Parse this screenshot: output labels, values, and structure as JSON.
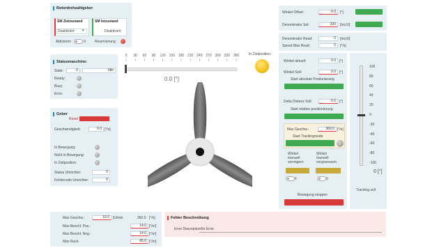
{
  "rotor": {
    "title": "Rotordrehzahlgeber",
    "soll_title": "SM Zielzustand",
    "soll_value": "Deaktiviert",
    "ist_title": "SM Istzustand",
    "ist_value": "Deaktiviert",
    "aktivieren_label": "Aktivieren",
    "aktivieren_value": "0",
    "reservierung_label": "Reservierung"
  },
  "status": {
    "title": "Statusmaschine:",
    "state_label": "State:",
    "state_value": "0",
    "state_text": "Idle",
    "ready_label": "Ready:",
    "busy_label": "Busy:",
    "error_label": "Error:"
  },
  "geber": {
    "title": "Geber",
    "reset_label": "Reset",
    "geschw_label": "Geschwindigkeit:",
    "geschw_value": "0.0",
    "geschw_unit": "[°/s]",
    "bewegung_label": "In Bewegung:",
    "nicht_bewegung_label": "Nicht in Bewegung:",
    "zielposition_label": "In Zielposition:",
    "umrichter_label": "Status Umrichter:",
    "umrichter_value": "0",
    "fehlercode_label": "Fehlercode Umrichter:",
    "fehlercode_value": "0"
  },
  "center": {
    "scale_ticks": [
      "0",
      "30",
      "60",
      "90",
      "120",
      "150",
      "180",
      "210",
      "240",
      "270",
      "300",
      "330",
      "360"
    ],
    "angle_readout": "0.0 [°]",
    "zielposition_label": "In Zielposition:",
    "slider_fraction": 0
  },
  "right": {
    "winkel_offset_label": "Winkel Offset:",
    "winkel_offset_value": "0.0",
    "winkel_offset_unit": "[°]",
    "denominator_set_label": "Denominator Set:",
    "denominator_set_value": "200",
    "denominator_set_unit": "[Inc/U]",
    "denominator_read_label": "Denominator Read:",
    "denominator_read_value": "0",
    "denominator_read_unit": "[Inc/U]",
    "speed_max_label": "Speed Max Read:",
    "speed_max_value": "0",
    "speed_max_unit": "[°/s]",
    "winkel_aktuell_label": "Winkel aktuell:",
    "winkel_aktuell_value": "0.0",
    "winkel_aktuell_unit": "[°]",
    "winkel_soll_label": "Winkel Soll:",
    "winkel_soll_value": "0.0",
    "winkel_soll_unit": "[°]",
    "start_absolute": "Start absolute Postionierung",
    "delta_label": "Delta Distanz Soll:",
    "delta_value": "0.0",
    "delta_unit": "[°]",
    "start_relative": "Start relative positionierung",
    "max_geschw_label": "Max Geschw.:",
    "max_geschw_value": "360.0",
    "max_geschw_unit": "[°/s]",
    "start_tracking": "Start Trackingmode",
    "winkel_verringern": "Winkel\nmanuell\nverringern",
    "winkel_vergroessern": "Winkel\nmanuell\nvergroessern",
    "counter_left": "0",
    "counter_right": "0",
    "bewegung_stoppen": "Bewegung stoppen"
  },
  "tracking": {
    "ticks": [
      "100",
      "80",
      "60",
      "40",
      "20",
      "0",
      "-20",
      "-40",
      "-60",
      "-80",
      "-100"
    ],
    "value_readout": "0 [°]",
    "label": "Tracking soll",
    "slider_value": 0
  },
  "bottom": {
    "max_geschw_label": "Max Geschw.:",
    "max_geschw_value": "15.0",
    "max_geschw_unit": "[U/min",
    "max_geschw_value2": "360.0",
    "max_geschw_unit2": "[°/s]",
    "beschl_pos_label": "Max Beschl. Pos.:",
    "beschl_pos_value": "14.0",
    "beschl_pos_unit": "[°/s²]",
    "beschl_neg_label": "Max Beschl. Neg.:",
    "beschl_neg_value": "14.0",
    "beschl_neg_unit": "[°/s²]",
    "ruck_label": "Max Ruck:",
    "ruck_value": "85.0",
    "ruck_unit": "[°/s³]"
  },
  "fehler": {
    "title": "Fehler Beschreibung",
    "desc_label": "Error Description:",
    "desc_value": "No Error"
  },
  "colors": {
    "green": "#3faa52",
    "red": "#d83a3a",
    "yellow_led": "#f2c21a",
    "accent": "#1a86c8"
  }
}
